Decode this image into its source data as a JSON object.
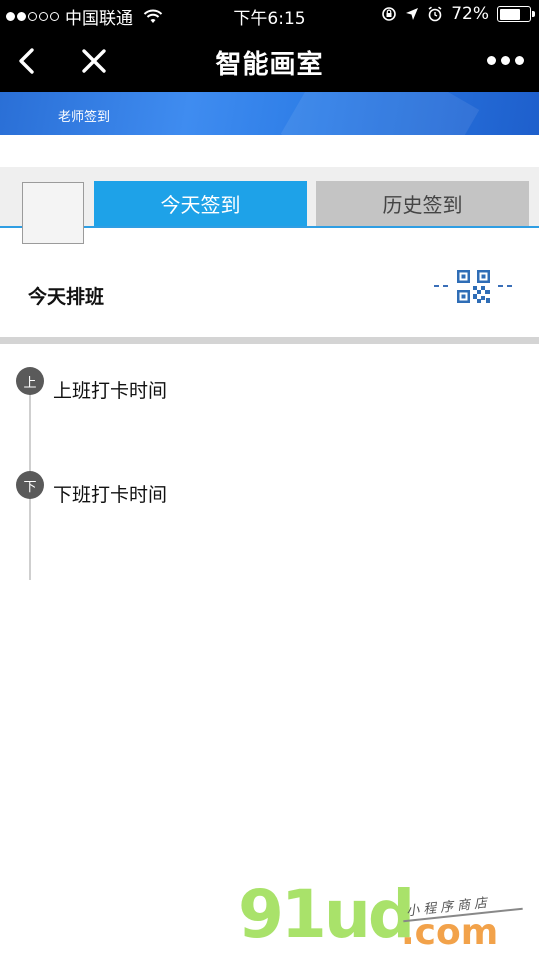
{
  "status_bar": {
    "carrier": "中国联通",
    "time": "下午6:15",
    "battery": "72%",
    "battery_level": 0.72
  },
  "nav": {
    "title": "智能画室"
  },
  "banner": {
    "role_text": "老师签到"
  },
  "tabs": {
    "today": "今天签到",
    "history": "历史签到"
  },
  "schedule": {
    "label": "今天排班"
  },
  "timeline": {
    "start_badge": "上",
    "start_label": "上班打卡时间",
    "end_badge": "下",
    "end_label": "下班打卡时间"
  },
  "watermark": {
    "main": "91ud",
    "dotcom": ".com",
    "small": "小程序商店"
  },
  "colors": {
    "tab_active": "#1ea2e8",
    "tab_inactive": "#c4c4c4",
    "banner": "#2c7ce6",
    "qr": "#2f6db6"
  }
}
